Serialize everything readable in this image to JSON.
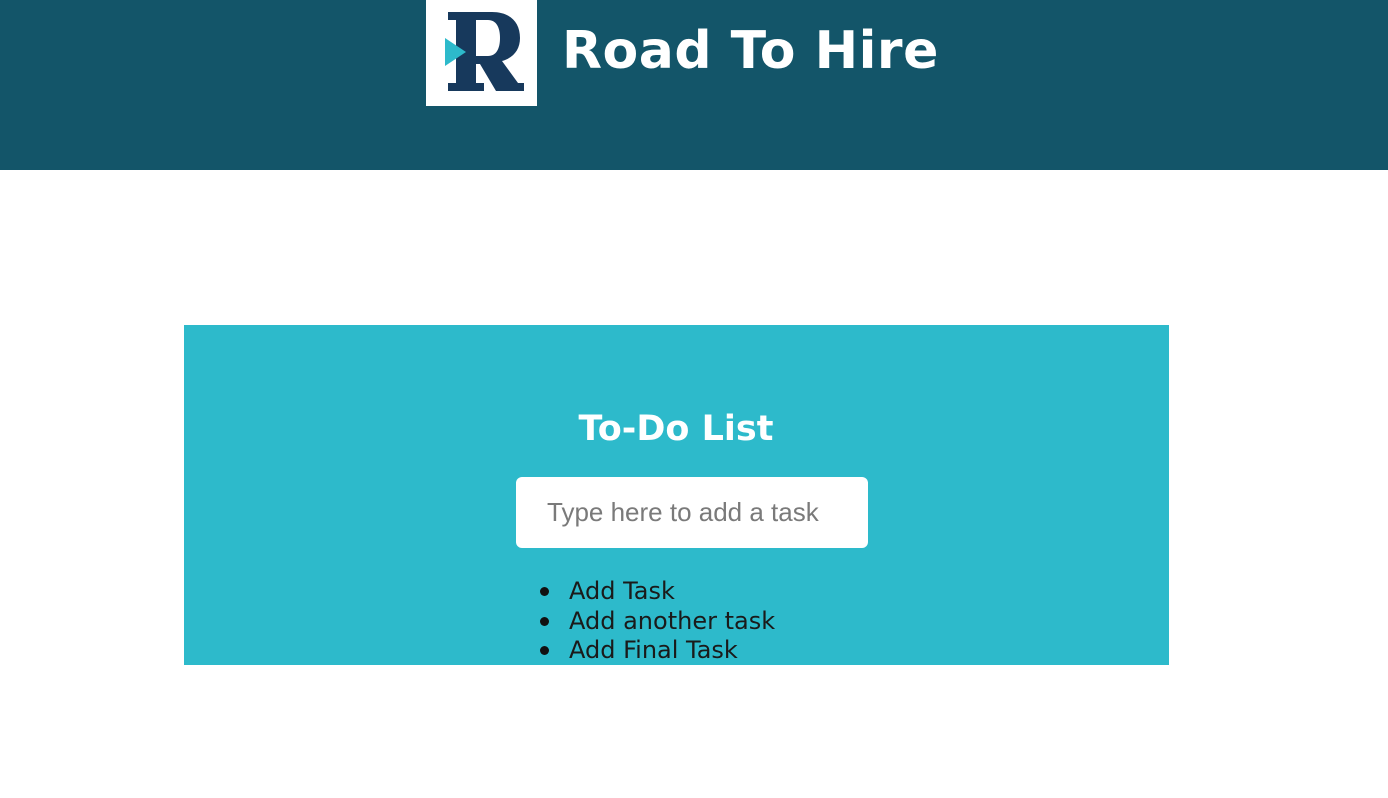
{
  "header": {
    "brand_name": "Road To Hire",
    "logo_icon": "road-to-hire-r-logo",
    "background_color": "#135569"
  },
  "todo": {
    "title": "To-Do List",
    "input": {
      "placeholder": "Type here to add a task",
      "value": ""
    },
    "tasks": [
      {
        "label": "Add Task"
      },
      {
        "label": "Add another task"
      },
      {
        "label": "Add Final Task"
      }
    ],
    "background_color": "#2dbacb"
  }
}
